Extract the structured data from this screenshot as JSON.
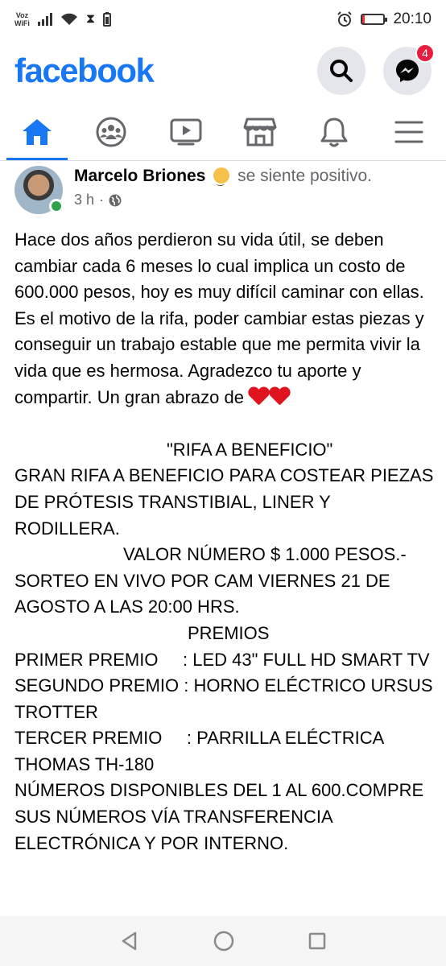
{
  "status_bar": {
    "carrier_top": "Voz",
    "carrier_bottom": "WiFi",
    "time": "20:10",
    "battery_level": 0.1,
    "battery_color": "#e53935"
  },
  "header": {
    "logo": "facebook",
    "messenger_badge": "4",
    "brand_color": "#1877f2"
  },
  "nav": {
    "tabs": [
      "home-icon",
      "groups-icon",
      "watch-icon",
      "marketplace-icon",
      "notifications-icon",
      "menu-icon"
    ],
    "active": "home-icon"
  },
  "post": {
    "author": "Marcelo Briones",
    "feeling": "se siente positivo.",
    "time": "3 h",
    "separator": "·",
    "paragraph": "Hace dos años perdieron su vida útil, se deben cambiar cada 6 meses lo cual implica un costo de 600.000 pesos, hoy es muy difícil caminar con ellas. Es el motivo de la rifa, poder cambiar estas piezas y conseguir un trabajo estable que me permita vivir la vida que es hermosa. Agradezco tu aporte y compartir. Un gran abrazo de",
    "raffle_title": "\"RIFA A BENEFICIO\"",
    "raffle_desc": "GRAN RIFA A BENEFICIO PARA COSTEAR PIEZAS DE PRÓTESIS TRANSTIBIAL, LINER Y RODILLERA.",
    "price": "VALOR NÚMERO $ 1.000 PESOS.-",
    "draw": "SORTEO EN VIVO POR CAM VIERNES 21 DE AGOSTO A LAS 20:00 HRS.",
    "prizes_heading": "PREMIOS",
    "prize_1_label": "PRIMER PREMIO     ",
    "prize_1_value": ": LED 43\" FULL HD SMART TV",
    "prize_2_label": "SEGUNDO PREMIO ",
    "prize_2_value": ": HORNO ELÉCTRICO URSUS TROTTER",
    "prize_3_label": "TERCER PREMIO     ",
    "prize_3_value": ": PARRILLA ELÉCTRICA THOMAS TH-180",
    "numbers": "NÚMEROS DISPONIBLES DEL 1 AL 600.COMPRE SUS NÚMEROS VÍA TRANSFERENCIA ELECTRÓNICA Y POR INTERNO."
  }
}
